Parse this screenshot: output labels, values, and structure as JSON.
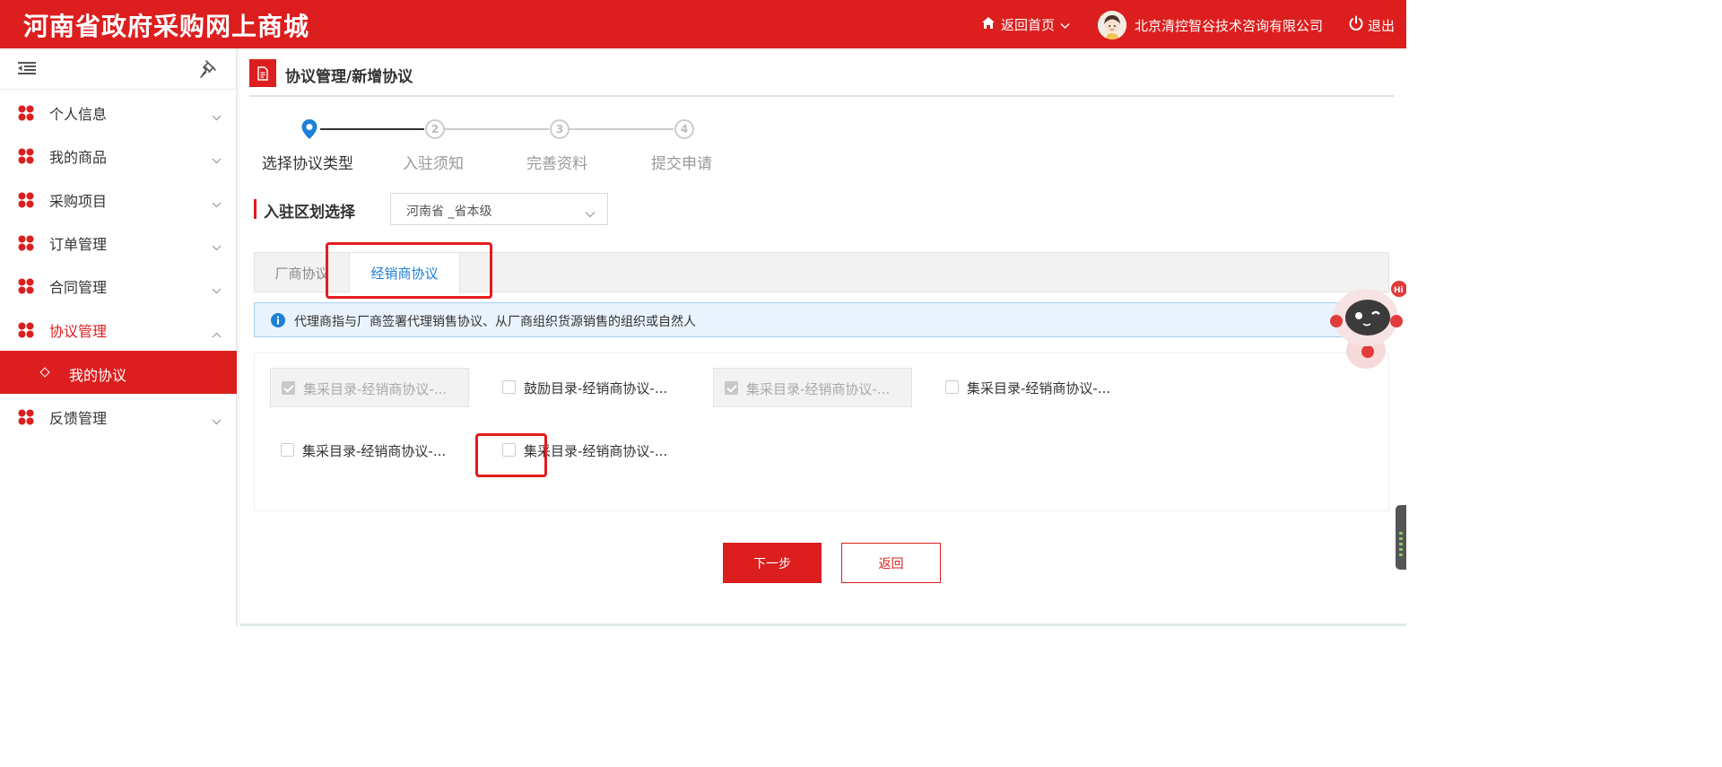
{
  "header": {
    "brand": "河南省政府采购网上商城",
    "home_label": "返回首页",
    "company": "北京清控智谷技术咨询有限公司",
    "logout_label": "退出"
  },
  "sidebar": {
    "items": [
      {
        "label": "个人信息",
        "state": "collapsed"
      },
      {
        "label": "我的商品",
        "state": "collapsed"
      },
      {
        "label": "采购项目",
        "state": "collapsed"
      },
      {
        "label": "订单管理",
        "state": "collapsed"
      },
      {
        "label": "合同管理",
        "state": "collapsed"
      },
      {
        "label": "协议管理",
        "state": "expanded"
      },
      {
        "label": "反馈管理",
        "state": "collapsed"
      }
    ],
    "active_sub": "我的协议"
  },
  "page": {
    "title": "协议管理/新增协议"
  },
  "steps": [
    {
      "label": "选择协议类型",
      "number": "",
      "active": true
    },
    {
      "label": "入驻须知",
      "number": "2",
      "active": false
    },
    {
      "label": "完善资料",
      "number": "3",
      "active": false
    },
    {
      "label": "提交申请",
      "number": "4",
      "active": false
    }
  ],
  "region": {
    "label": "入驻区划选择",
    "value": "河南省 _省本级"
  },
  "tabs": [
    {
      "label": "厂商协议",
      "selected": false
    },
    {
      "label": "经销商协议",
      "selected": true
    }
  ],
  "info": {
    "text": "代理商指与厂商签署代理销售协议、从厂商组织货源销售的组织或自然人"
  },
  "options": [
    {
      "label": "集采目录-经销商协议-...",
      "checked": true,
      "disabled": true
    },
    {
      "label": "鼓励目录-经销商协议-...",
      "checked": false,
      "disabled": false
    },
    {
      "label": "集采目录-经销商协议-...",
      "checked": true,
      "disabled": true
    },
    {
      "label": "集采目录-经销商协议-...",
      "checked": false,
      "disabled": false
    },
    {
      "label": "集采目录-经销商协议-...",
      "checked": false,
      "disabled": false
    },
    {
      "label": "集采目录-经销商协议-...",
      "checked": false,
      "disabled": false
    }
  ],
  "buttons": {
    "next": "下一步",
    "back": "返回"
  },
  "colors": {
    "brand_red": "#dc1e1e",
    "link_blue": "#1e80d8",
    "info_bg": "#e8f3fd"
  }
}
